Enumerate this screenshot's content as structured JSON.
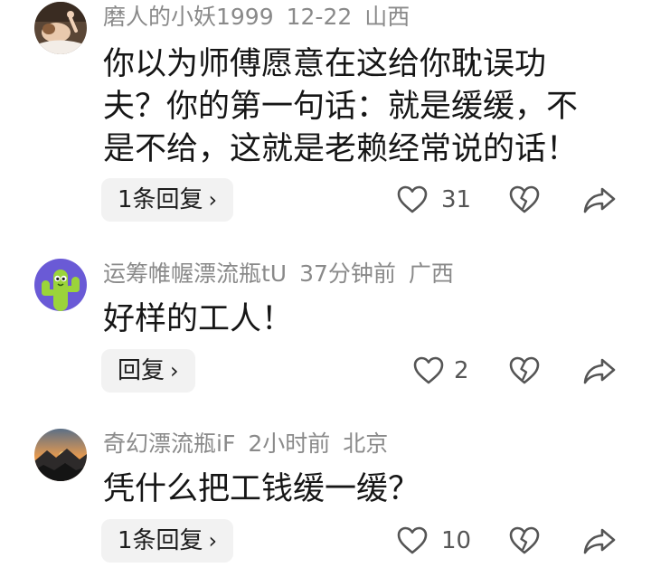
{
  "comments": [
    {
      "username": "磨人的小妖1999",
      "time": "12-22",
      "location": "山西",
      "text_lines": [
        "你以为师傅愿意在这给你耽误功",
        "夫？你的第一句话：就是缓缓，不",
        "是不给，这就是老赖经常说的话！"
      ],
      "reply_label": "1条回复",
      "reply_chevron": "›",
      "like_count": "31",
      "avatar_icon": "spa-portrait-avatar"
    },
    {
      "username": "运筹帷幄漂流瓶tU",
      "time": "37分钟前",
      "location": "广西",
      "text_lines": [
        "好样的工人！"
      ],
      "reply_label": "回复",
      "reply_chevron": "›",
      "like_count": "2",
      "avatar_icon": "cactus-avatar"
    },
    {
      "username": "奇幻漂流瓶iF",
      "time": "2小时前",
      "location": "北京",
      "text_lines": [
        "凭什么把工钱缓一缓？"
      ],
      "reply_label": "1条回复",
      "reply_chevron": "›",
      "like_count": "10",
      "avatar_icon": "mountain-sunset-avatar"
    }
  ],
  "icons": {
    "like": "heart-outline-icon",
    "dislike": "broken-heart-icon",
    "share": "share-arrow-icon"
  },
  "colors": {
    "meta": "#8a8a8a",
    "text": "#161616",
    "reply_bg": "#f2f2f2",
    "icon": "#555555",
    "avatar_purple": "#6a5ad6",
    "cactus_green": "#9bd43a"
  }
}
